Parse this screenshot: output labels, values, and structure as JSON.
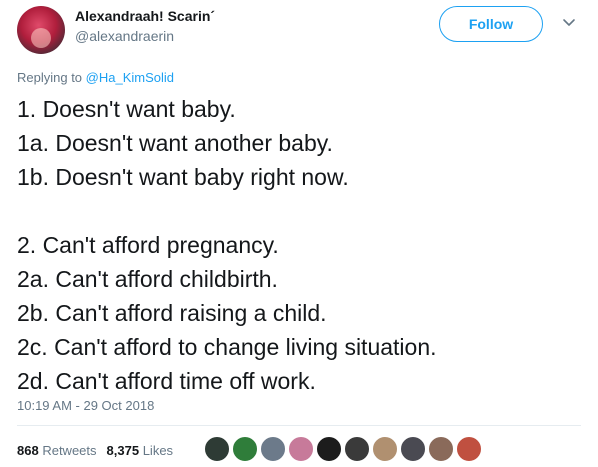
{
  "author": {
    "display_name": "Alexandraah! Scarin´",
    "handle": "@alexandraerin"
  },
  "follow_label": "Follow",
  "reply": {
    "prefix": "Replying to",
    "to": "@Ha_KimSolid"
  },
  "tweet_lines": [
    "1. Doesn't want baby.",
    "1a. Doesn't want another baby.",
    "1b. Doesn't want baby right now.",
    "",
    "2. Can't afford pregnancy.",
    "2a. Can't afford childbirth.",
    "2b. Can't afford raising a child.",
    "2c. Can't afford to change living situation.",
    "2d. Can't afford time off work."
  ],
  "timestamp": "10:19 AM - 29 Oct 2018",
  "stats": {
    "retweets_count": "868",
    "retweets_label": "Retweets",
    "likes_count": "8,375",
    "likes_label": "Likes"
  },
  "colors": {
    "accent": "#1da1f2",
    "secondary_text": "#657786",
    "divider": "#e6ecf0"
  },
  "liker_avatars": [
    {
      "name": "liker-avatar-1",
      "color": "#2e3b35"
    },
    {
      "name": "liker-avatar-2",
      "color": "#2f7d3a"
    },
    {
      "name": "liker-avatar-3",
      "color": "#6c7a8a"
    },
    {
      "name": "liker-avatar-4",
      "color": "#c77a9a"
    },
    {
      "name": "liker-avatar-5",
      "color": "#1c1c1c"
    },
    {
      "name": "liker-avatar-6",
      "color": "#3a3a3a"
    },
    {
      "name": "liker-avatar-7",
      "color": "#b09070"
    },
    {
      "name": "liker-avatar-8",
      "color": "#4a4a52"
    },
    {
      "name": "liker-avatar-9",
      "color": "#8a6a5a"
    },
    {
      "name": "liker-avatar-10",
      "color": "#c05040"
    }
  ]
}
